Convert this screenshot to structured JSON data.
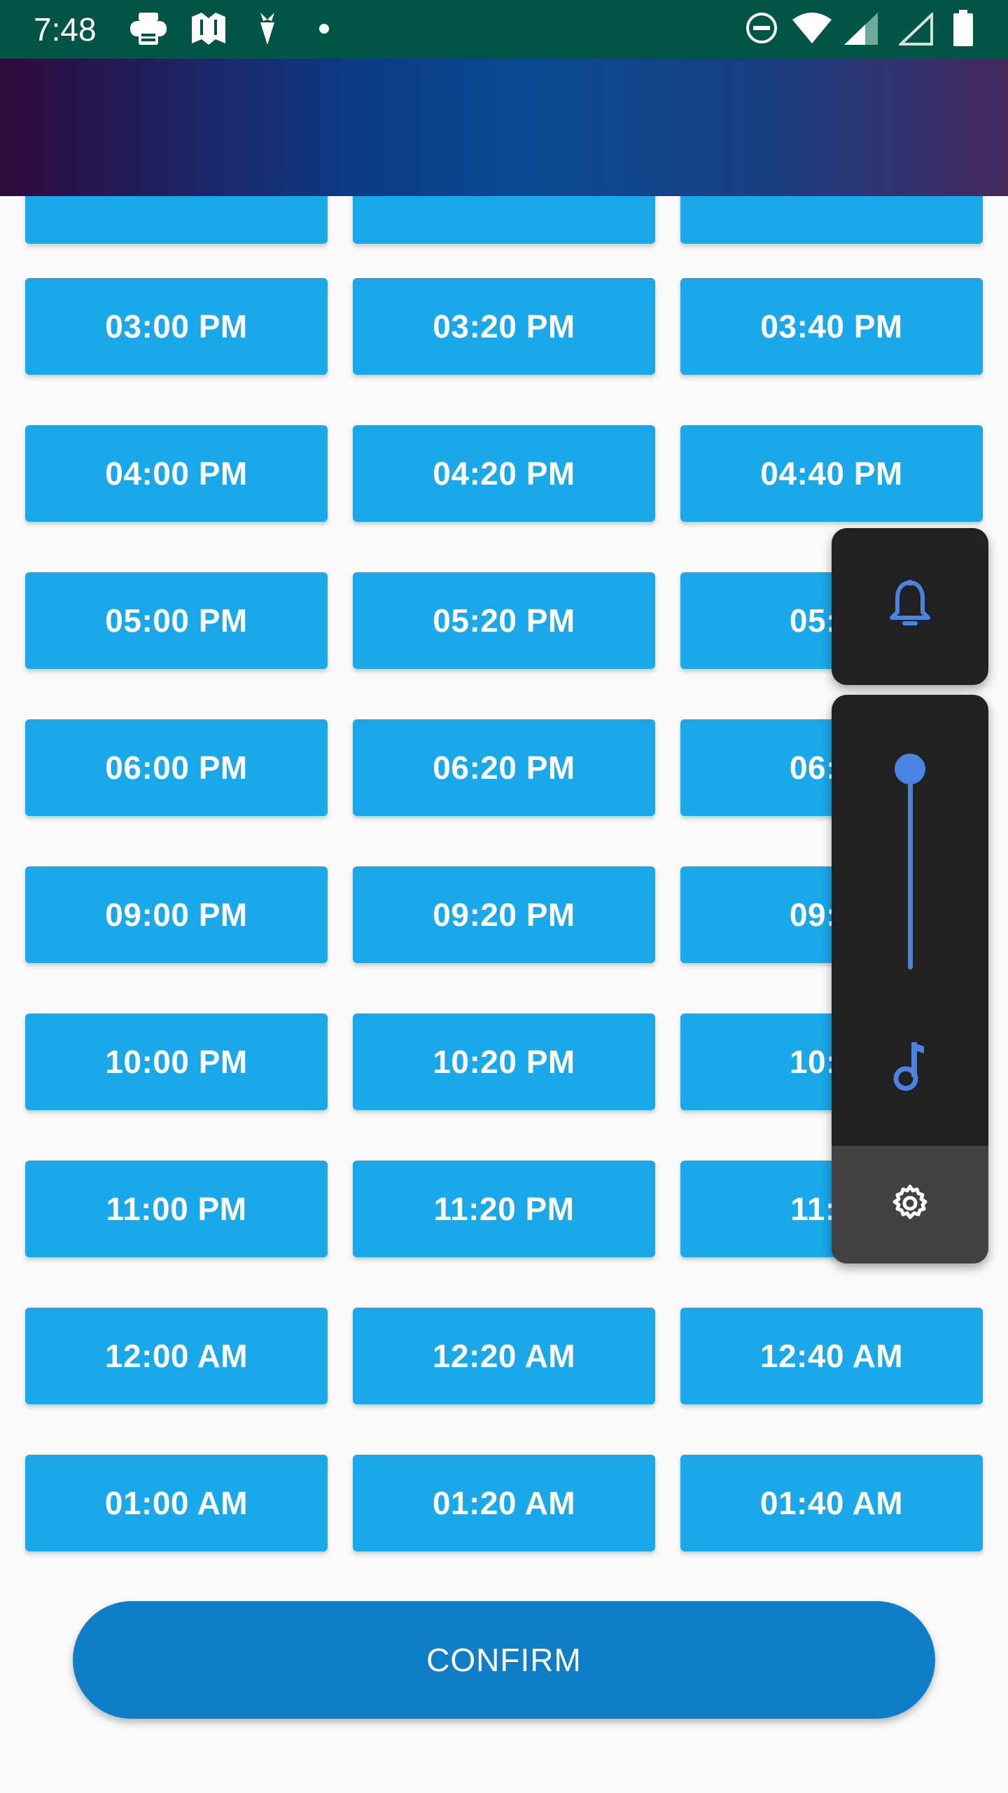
{
  "status_bar": {
    "time": "7:48",
    "notification_icons": [
      "printer-icon",
      "maps-icon",
      "carrot-icon",
      "dot-icon"
    ],
    "system_icons": [
      "do-not-disturb-icon",
      "wifi-icon",
      "signal-icon",
      "signal-empty-icon",
      "battery-icon"
    ],
    "background_color": "#005546"
  },
  "time_slots": {
    "rows": [
      [
        "",
        "",
        ""
      ],
      [
        "03:00 PM",
        "03:20 PM",
        "03:40 PM"
      ],
      [
        "04:00 PM",
        "04:20 PM",
        "04:40 PM"
      ],
      [
        "05:00 PM",
        "05:20 PM",
        "05:40"
      ],
      [
        "06:00 PM",
        "06:20 PM",
        "06:40"
      ],
      [
        "09:00 PM",
        "09:20 PM",
        "09:40"
      ],
      [
        "10:00 PM",
        "10:20 PM",
        "10:40"
      ],
      [
        "11:00 PM",
        "11:20 PM",
        "11:40"
      ],
      [
        "12:00 AM",
        "12:20 AM",
        "12:40 AM"
      ],
      [
        "01:00 AM",
        "01:20 AM",
        "01:40 AM"
      ]
    ],
    "slot_color": "#19a8ea"
  },
  "confirm": {
    "label": "CONFIRM",
    "color": "#0f7ec7"
  },
  "volume_panel": {
    "ringer_icon": "bell-icon",
    "media_icon": "music-note-icon",
    "settings_icon": "gear-icon",
    "level_fraction": 1.0,
    "accent_color": "#4a83e2"
  }
}
